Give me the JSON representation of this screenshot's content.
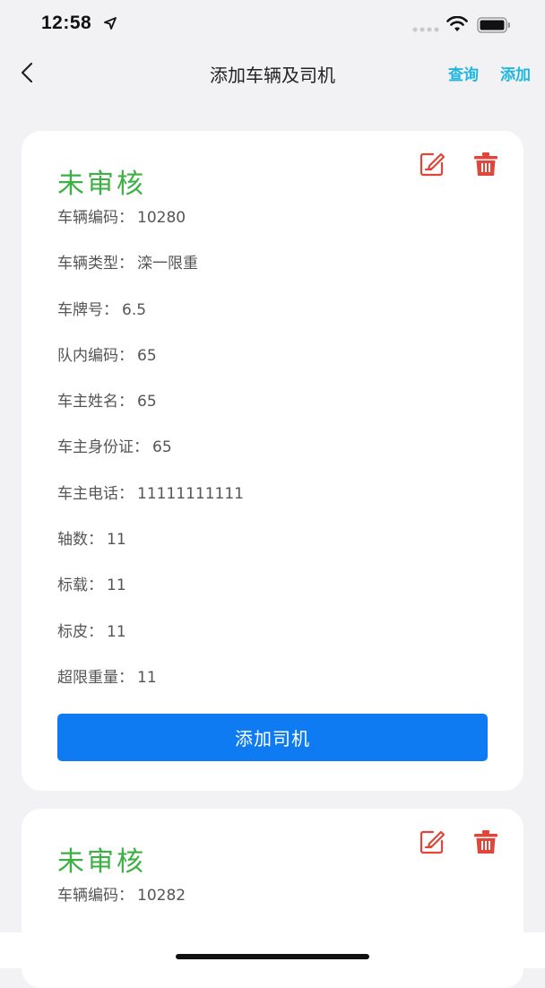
{
  "status_bar": {
    "time": "12:58"
  },
  "nav": {
    "title": "添加车辆及司机",
    "query_label": "查询",
    "add_label": "添加"
  },
  "colors": {
    "accent": "#1fb7e0",
    "status_green": "#3cb043",
    "icon_red": "#e0473a",
    "button_blue": "#0f7bf2"
  },
  "cards": [
    {
      "status": "未审核",
      "fields": [
        {
          "label": "车辆编码：",
          "value": "10280"
        },
        {
          "label": "车辆类型：",
          "value": "滦一限重"
        },
        {
          "label": "车牌号：",
          "value": "6.5"
        },
        {
          "label": "队内编码：",
          "value": "65"
        },
        {
          "label": "车主姓名：",
          "value": "65"
        },
        {
          "label": "车主身份证：",
          "value": "65"
        },
        {
          "label": "车主电话：",
          "value": "11111111111"
        },
        {
          "label": "轴数：",
          "value": "11"
        },
        {
          "label": "标载：",
          "value": "11"
        },
        {
          "label": "标皮：",
          "value": "11"
        },
        {
          "label": "超限重量：",
          "value": "11"
        }
      ],
      "button_label": "添加司机"
    },
    {
      "status": "未审核",
      "fields": [
        {
          "label": "车辆编码：",
          "value": "10282"
        }
      ]
    }
  ],
  "icons": {
    "edit": "edit-icon",
    "delete": "trash-icon",
    "back": "chevron-left-icon"
  }
}
